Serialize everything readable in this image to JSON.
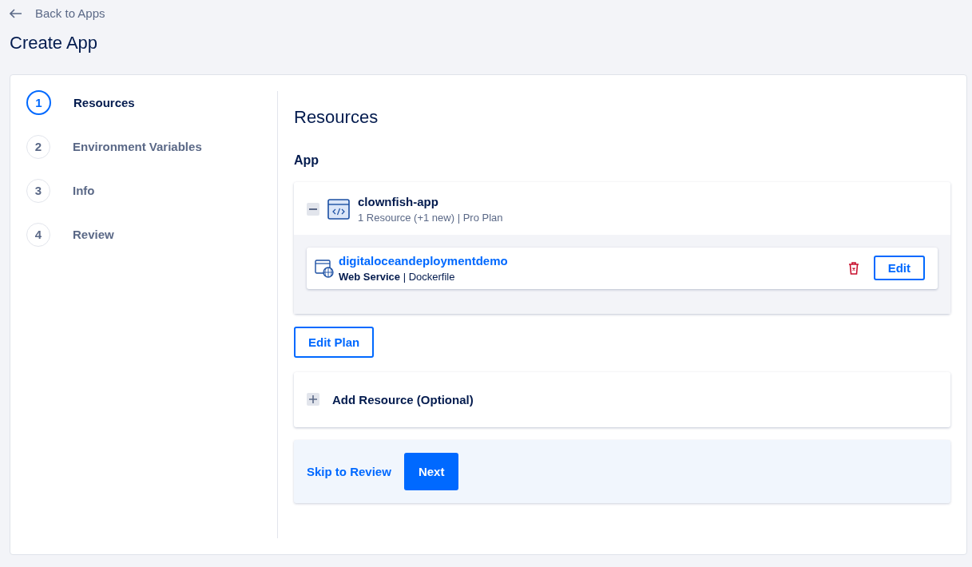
{
  "back_link": {
    "label": "Back to Apps"
  },
  "page_title": "Create App",
  "steps": [
    {
      "number": "1",
      "label": "Resources",
      "selected": true
    },
    {
      "number": "2",
      "label": "Environment Variables",
      "selected": false
    },
    {
      "number": "3",
      "label": "Info",
      "selected": false
    },
    {
      "number": "4",
      "label": "Review",
      "selected": false
    }
  ],
  "section_title": "Resources",
  "app_heading": "App",
  "app": {
    "name": "clownfish-app",
    "summary": "1 Resource (+1 new) | Pro Plan",
    "expanded": true,
    "components": [
      {
        "name": "digitaloceandeploymentdemo",
        "detail": "**Web Service** | Dockerfile",
        "edit_label": "Edit"
      }
    ]
  },
  "edit_plan_label": "Edit Plan",
  "add_resource": {
    "label": "Add Resource (Optional)",
    "expanded": false
  },
  "footer": {
    "skip_label": "Skip to Review",
    "next_label": "Next"
  }
}
